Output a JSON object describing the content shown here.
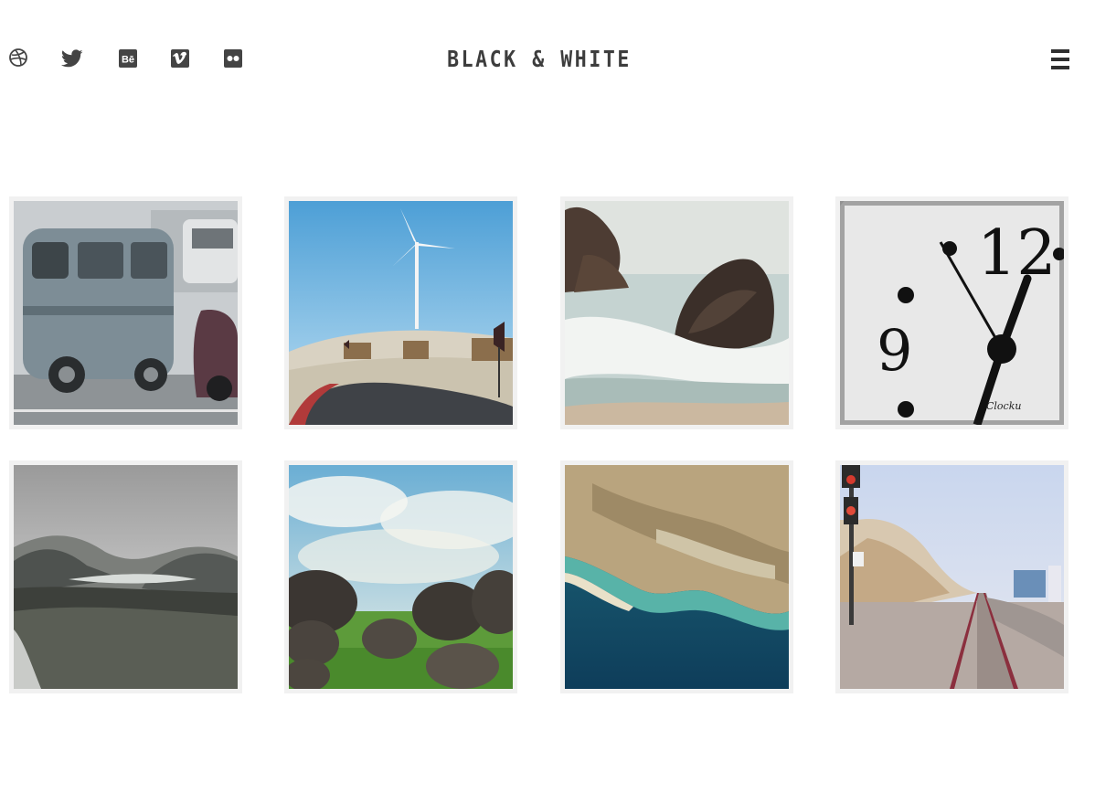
{
  "header": {
    "brand": "BLACK & WHITE"
  },
  "social": [
    {
      "name": "dribbble-icon"
    },
    {
      "name": "twitter-icon"
    },
    {
      "name": "behance-icon"
    },
    {
      "name": "vimeo-icon"
    },
    {
      "name": "flickr-icon"
    }
  ],
  "colors": {
    "icon": "#444444",
    "brand_text": "#3d3d3d",
    "tile_frame": "#f1f1f1",
    "background": "#ffffff"
  },
  "gallery": [
    {
      "name": "vw-van-photo"
    },
    {
      "name": "wind-turbine-road-photo"
    },
    {
      "name": "sea-rocks-photo"
    },
    {
      "name": "clock-face-photo"
    },
    {
      "name": "mountain-valley-photo"
    },
    {
      "name": "boulders-field-photo"
    },
    {
      "name": "aerial-coast-photo"
    },
    {
      "name": "railway-tracks-photo"
    }
  ]
}
